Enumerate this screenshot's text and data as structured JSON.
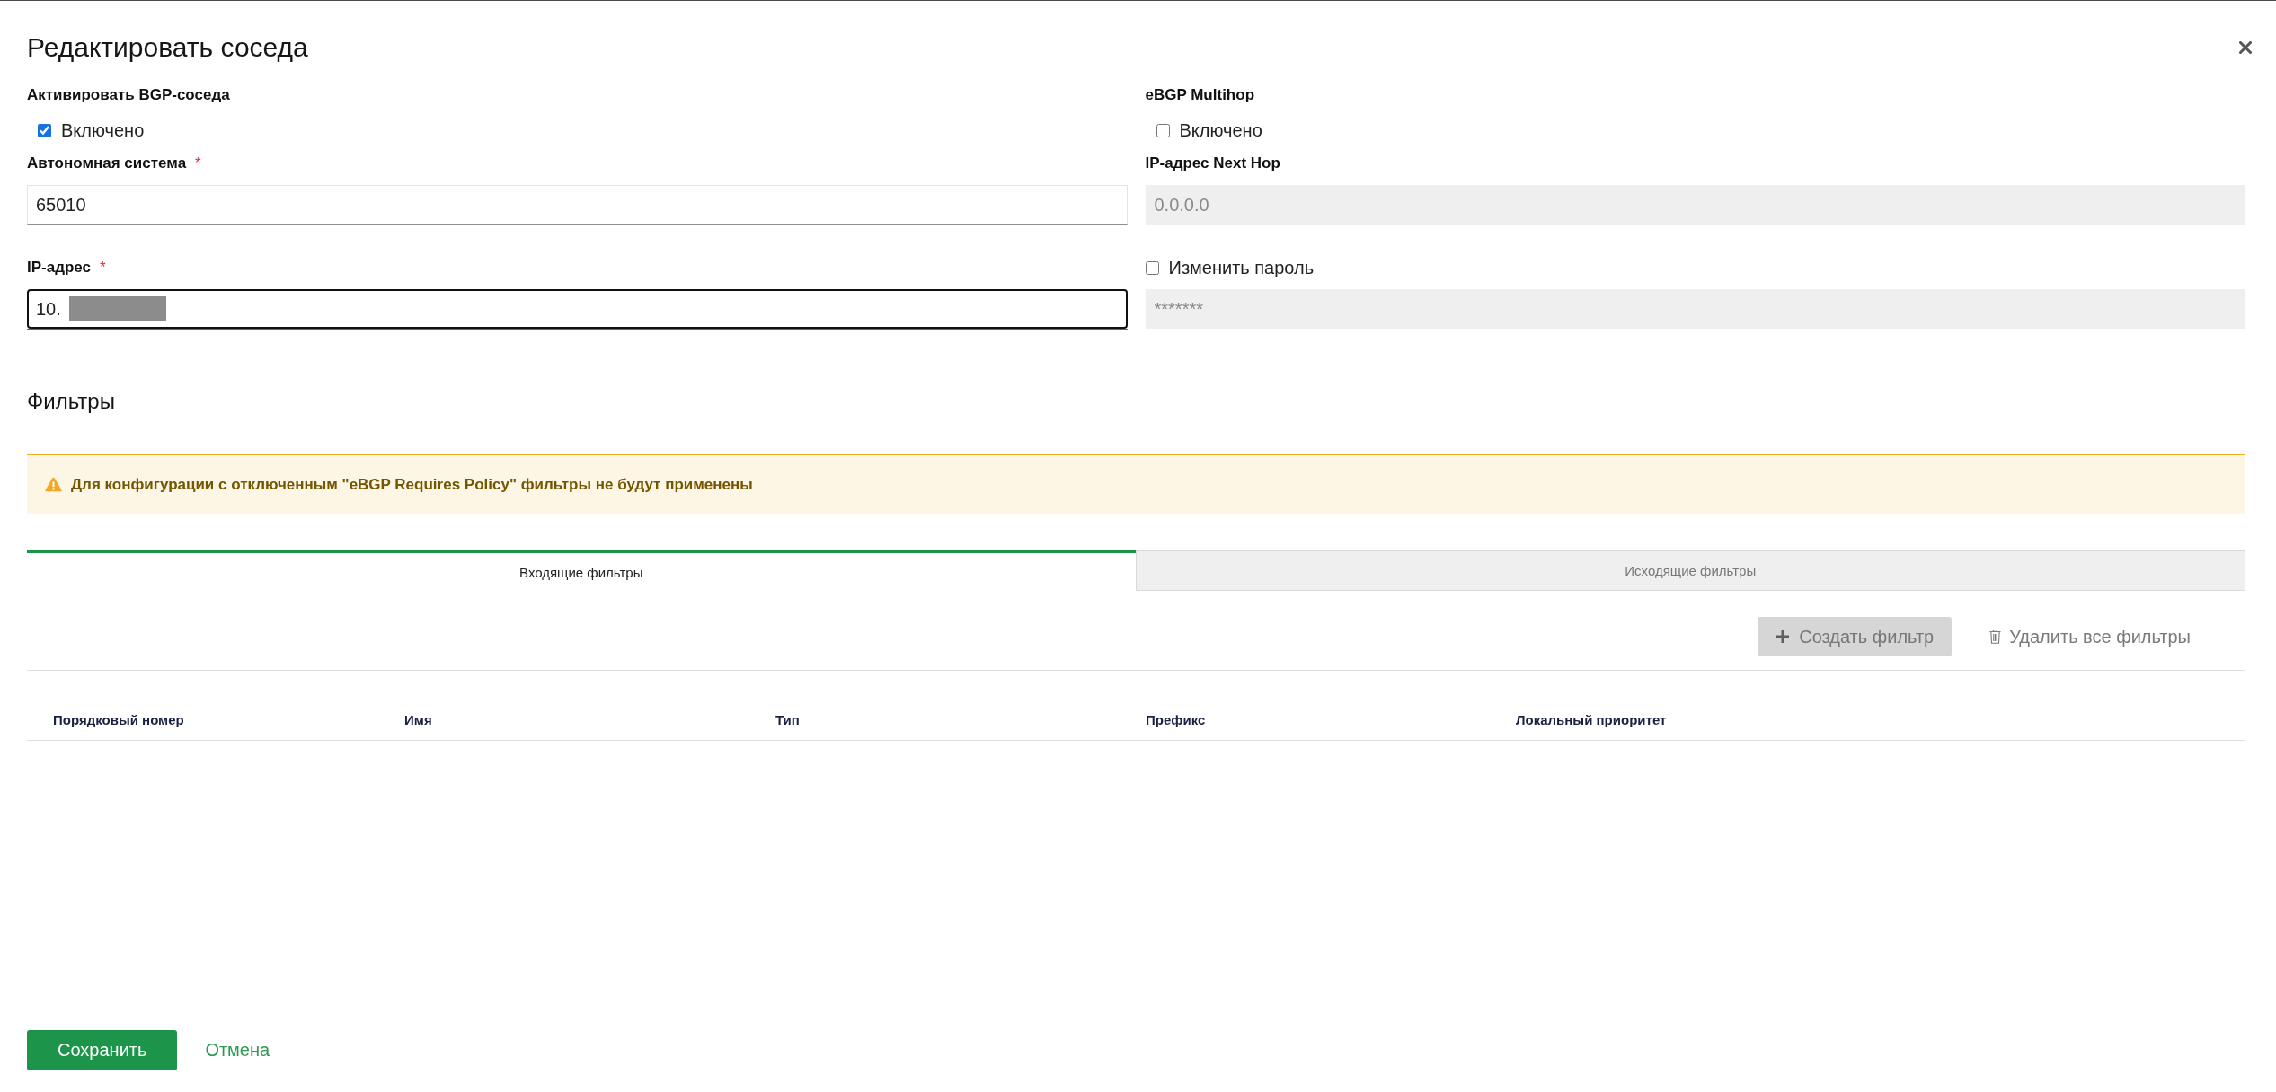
{
  "dialog": {
    "title": "Редактировать соседа"
  },
  "form": {
    "columns": [
      [
        {
          "kind": "checkbox",
          "label": "Активировать BGP-соседа",
          "option": "Включено",
          "checked": true
        },
        {
          "kind": "input",
          "label": "Автономная система",
          "required_mark": "*",
          "value": "65010",
          "focused": false,
          "disabled": false,
          "redacted": false
        },
        {
          "kind": "input",
          "label": "IP-адрес",
          "required_mark": "*",
          "value": "10.",
          "focused": true,
          "disabled": false,
          "redacted": true
        }
      ],
      [
        {
          "kind": "checkbox",
          "label": "eBGP Multihop",
          "option": "Включено",
          "checked": false
        },
        {
          "kind": "input",
          "label": "IP-адрес Next Hop",
          "placeholder": "0.0.0.0",
          "focused": false,
          "disabled": true,
          "redacted": false
        },
        {
          "kind": "toggled-input",
          "option": "Изменить пароль",
          "checked": false,
          "placeholder": "*******",
          "focused": false,
          "disabled": true,
          "redacted": false
        }
      ]
    ]
  },
  "filters": {
    "title": "Фильтры",
    "alert": {
      "kind": "warning",
      "text": "Для конфигурации с отключенным \"eBGP Requires Policy\" фильтры не будут применены"
    },
    "tabs": [
      {
        "label": "Входящие фильтры",
        "selected": true
      },
      {
        "label": "Исходящие фильтры",
        "selected": false
      }
    ],
    "toolbar": [
      {
        "kind": "create",
        "label": "Создать фильтр",
        "disabled": true
      },
      {
        "kind": "delete",
        "label": "Удалить все фильтры",
        "disabled": true
      }
    ],
    "table": {
      "columns": [
        "Порядковый номер",
        "Имя",
        "Тип",
        "Префикс",
        "Локальный приоритет"
      ]
    }
  },
  "footer": {
    "buttons": [
      {
        "kind": "primary",
        "label": "Сохранить"
      },
      {
        "kind": "link",
        "label": "Отмена"
      }
    ]
  }
}
